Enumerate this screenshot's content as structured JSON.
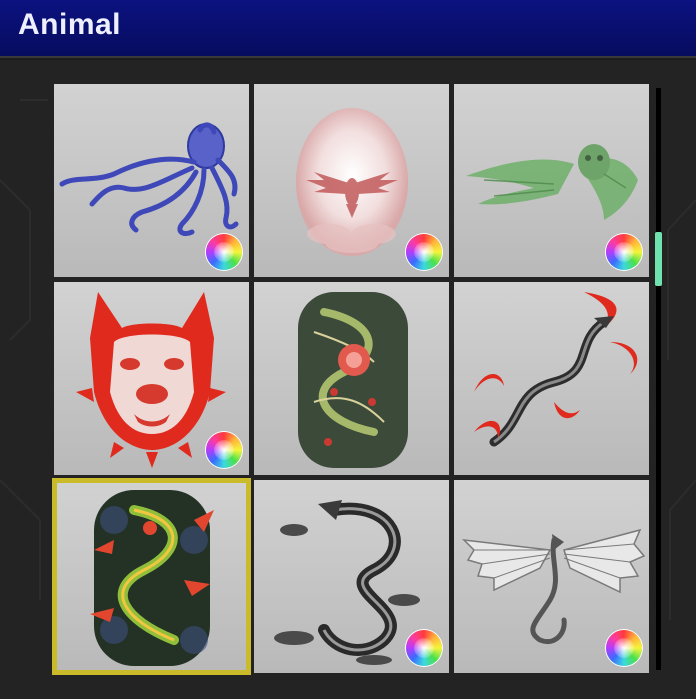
{
  "header": {
    "title": "Animal"
  },
  "colors": {
    "header_bg": "#0a1070",
    "selection": "#c9bb2a",
    "scroll_thumb": "#6fe2b0"
  },
  "tiles": [
    {
      "name": "octopus",
      "icon": "octopus-tattoo",
      "selected": false,
      "color_option": true
    },
    {
      "name": "dove",
      "icon": "dove-tattoo",
      "selected": false,
      "color_option": true
    },
    {
      "name": "owl-wings",
      "icon": "owl-wings-tattoo",
      "selected": false,
      "color_option": true
    },
    {
      "name": "pitbull",
      "icon": "pitbull-tattoo",
      "selected": false,
      "color_option": true
    },
    {
      "name": "dragon-sleeve",
      "icon": "dragon-sleeve-tattoo",
      "selected": false,
      "color_option": false
    },
    {
      "name": "red-dragon",
      "icon": "red-dragon-tattoo",
      "selected": false,
      "color_option": false
    },
    {
      "name": "dragon-colored-sleeve",
      "icon": "dragon-colored-sleeve-tattoo",
      "selected": true,
      "color_option": false
    },
    {
      "name": "black-dragon",
      "icon": "black-dragon-tattoo",
      "selected": false,
      "color_option": true
    },
    {
      "name": "winged-dragon",
      "icon": "winged-dragon-tattoo",
      "selected": false,
      "color_option": true
    }
  ],
  "scrollbar": {
    "position": 0.25
  }
}
